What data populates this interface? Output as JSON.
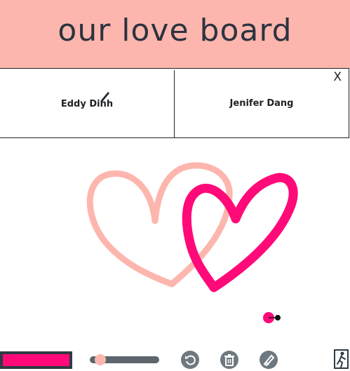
{
  "header": {
    "title": "our love board"
  },
  "players": [
    {
      "name": "Eddy Dinh",
      "drawing": true
    },
    {
      "name": "Jenifer Dang",
      "drawing": false
    }
  ],
  "close_label": "X",
  "colors": {
    "header_bg": "#fdb6ae",
    "left_heart": "#fdb6ae",
    "right_heart": "#ff0a78",
    "current_color": "#ff0a78",
    "tool_icon_bg": "#6e7880"
  },
  "brush": {
    "size_fraction": 0.15
  },
  "icons": {
    "drawing_indicator": "pen-icon",
    "undo": "undo-icon",
    "clear": "trash-icon",
    "pick_color": "eraser-pencil-icon",
    "leave": "exit-icon"
  }
}
